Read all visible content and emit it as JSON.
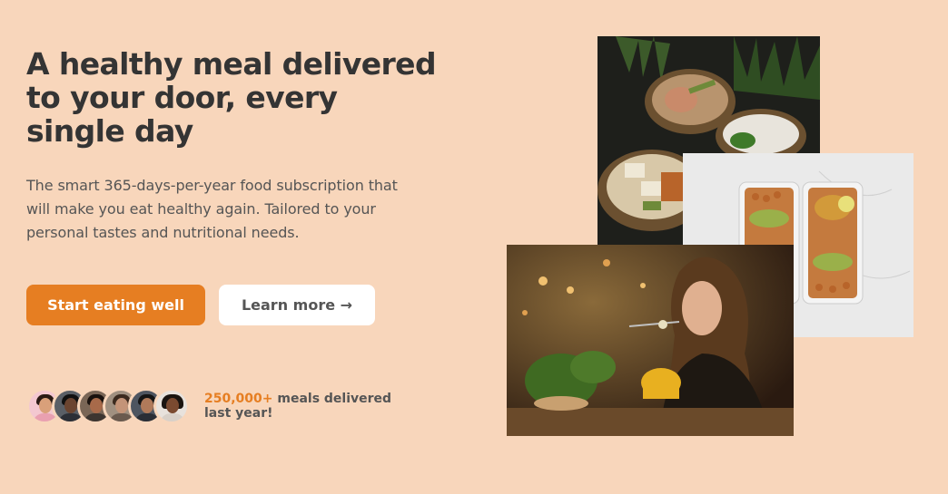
{
  "hero": {
    "title": "A healthy meal delivered to your door, every single day",
    "description": "The smart 365-days-per-year food subscription that will make you eat healthy again. Tailored to your personal tastes and nutritional needs.",
    "primary_button": "Start eating well",
    "secondary_button": "Learn more →"
  },
  "delivered": {
    "count": "250,000+",
    "text": " meals delivered last year!"
  },
  "colors": {
    "background": "#f8d6bb",
    "accent": "#e67e22",
    "text": "#343434"
  }
}
